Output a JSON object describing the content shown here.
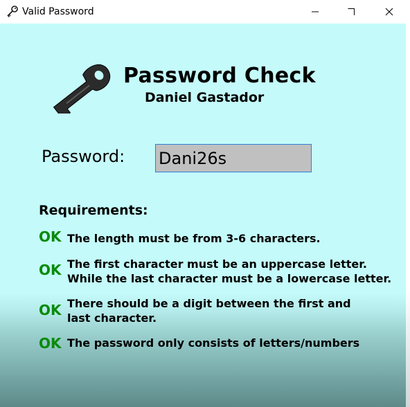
{
  "window": {
    "title": "Valid Password",
    "title_icon": "key-icon",
    "controls": {
      "minimize_icon": "minimize-icon",
      "maximize_icon": "maximize-icon",
      "close_icon": "close-icon"
    }
  },
  "header": {
    "logo_icon": "key-icon",
    "title": "Password Check",
    "author": "Daniel Gastador"
  },
  "password": {
    "label": "Password:",
    "value": "Dani26s"
  },
  "requirements": {
    "heading": "Requirements:",
    "items": [
      {
        "status": "OK",
        "lines": [
          "The length must be from 3-6 characters."
        ]
      },
      {
        "status": "OK",
        "lines": [
          "The first character must be an uppercase letter.",
          "While the last character must be a lowercase letter."
        ]
      },
      {
        "status": "OK",
        "lines": [
          "There should be a digit between the first and",
          "last character."
        ]
      },
      {
        "status": "OK",
        "lines": [
          "The password only consists of letters/numbers"
        ]
      }
    ]
  },
  "colors": {
    "background": "#c4fbfa",
    "ok": "#0a8a0a",
    "input_background": "#c0c0c0",
    "input_border": "#2d7fd3"
  }
}
